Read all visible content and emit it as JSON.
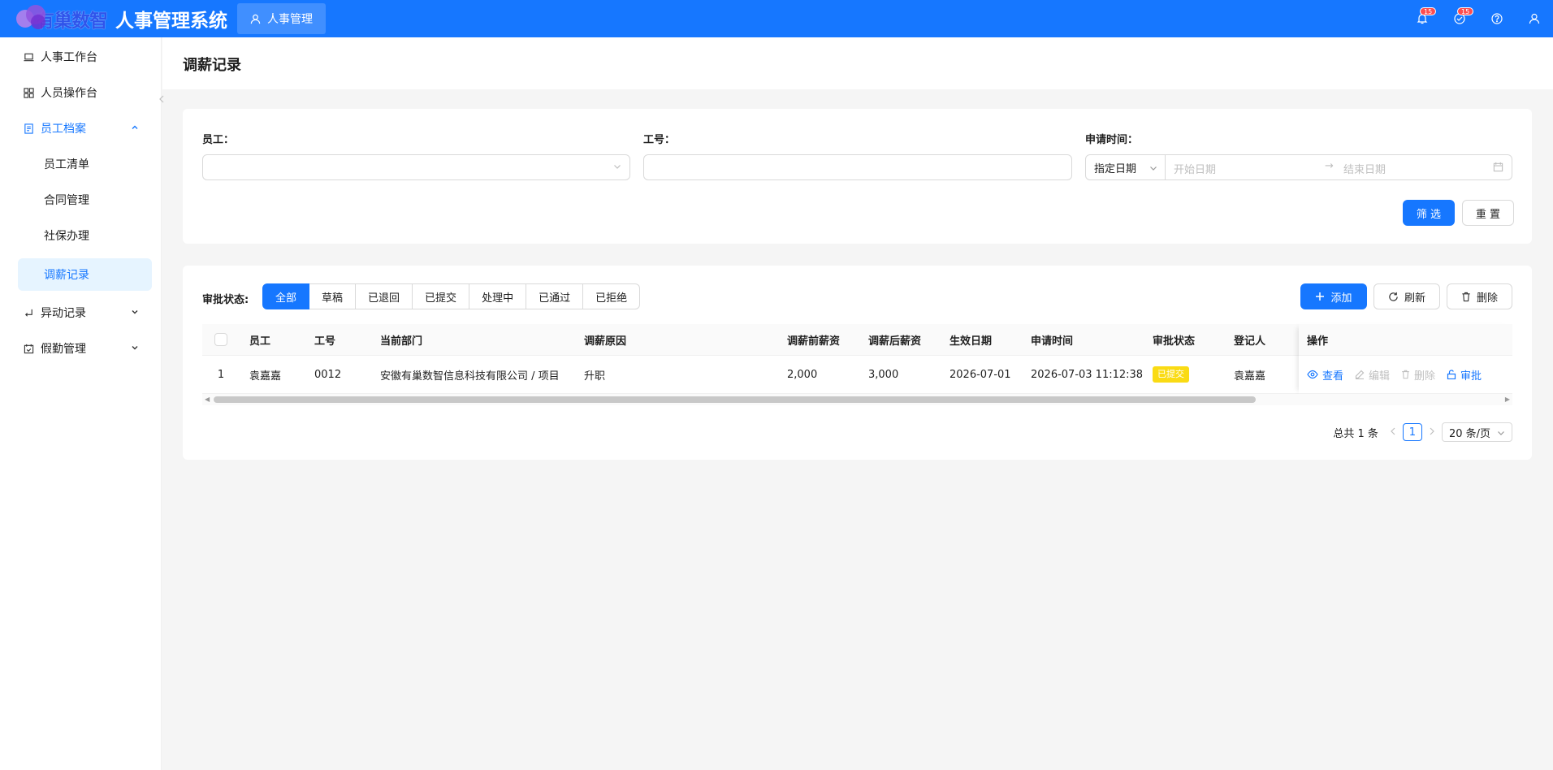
{
  "header": {
    "logo_text": "有巢数智",
    "system_title": "人事管理系统",
    "module_tab": "人事管理",
    "notifications_badge": "15",
    "tasks_badge": "15"
  },
  "sidebar": {
    "items": [
      {
        "label": "人事工作台"
      },
      {
        "label": "人员操作台"
      },
      {
        "label": "员工档案"
      },
      {
        "label": "员工清单"
      },
      {
        "label": "合同管理"
      },
      {
        "label": "社保办理"
      },
      {
        "label": "调薪记录"
      },
      {
        "label": "异动记录"
      },
      {
        "label": "假勤管理"
      }
    ]
  },
  "page": {
    "title": "调薪记录"
  },
  "filters": {
    "employee_label": "员工：",
    "employee_value": "",
    "job_no_label": "工号：",
    "job_no_value": "",
    "apply_time_label": "申请时间：",
    "range_type": "指定日期",
    "start_placeholder": "开始日期",
    "end_placeholder": "结束日期",
    "filter_button": "筛 选",
    "reset_button": "重 置"
  },
  "toolbar": {
    "status_label": "审批状态:",
    "statuses": [
      "全部",
      "草稿",
      "已退回",
      "已提交",
      "处理中",
      "已通过",
      "已拒绝"
    ],
    "active_status": "全部",
    "add_button": "添加",
    "refresh_button": "刷新",
    "delete_button": "删除"
  },
  "table": {
    "columns": [
      "员工",
      "工号",
      "当前部门",
      "调薪原因",
      "调薪前薪资",
      "调薪后薪资",
      "生效日期",
      "申请时间",
      "审批状态",
      "登记人",
      "操作"
    ],
    "rows": [
      {
        "index": "1",
        "employee": "袁嘉嘉",
        "job_no": "0012",
        "department": "安徽有巢数智信息科技有限公司 / 项目",
        "reason": "升职",
        "salary_before": "2,000",
        "salary_after": "3,000",
        "effective_date": "2026-07-01",
        "apply_time": "2026-07-03 11:12:38",
        "status": "已提交",
        "registrar": "袁嘉嘉",
        "actions": [
          "查看",
          "编辑",
          "删除",
          "审批"
        ]
      }
    ]
  },
  "pagination": {
    "total_text": "总共 1 条",
    "current_page": "1",
    "page_size": "20 条/页"
  },
  "colors": {
    "primary": "#1677ff",
    "status_submitted": "#fadb14"
  }
}
